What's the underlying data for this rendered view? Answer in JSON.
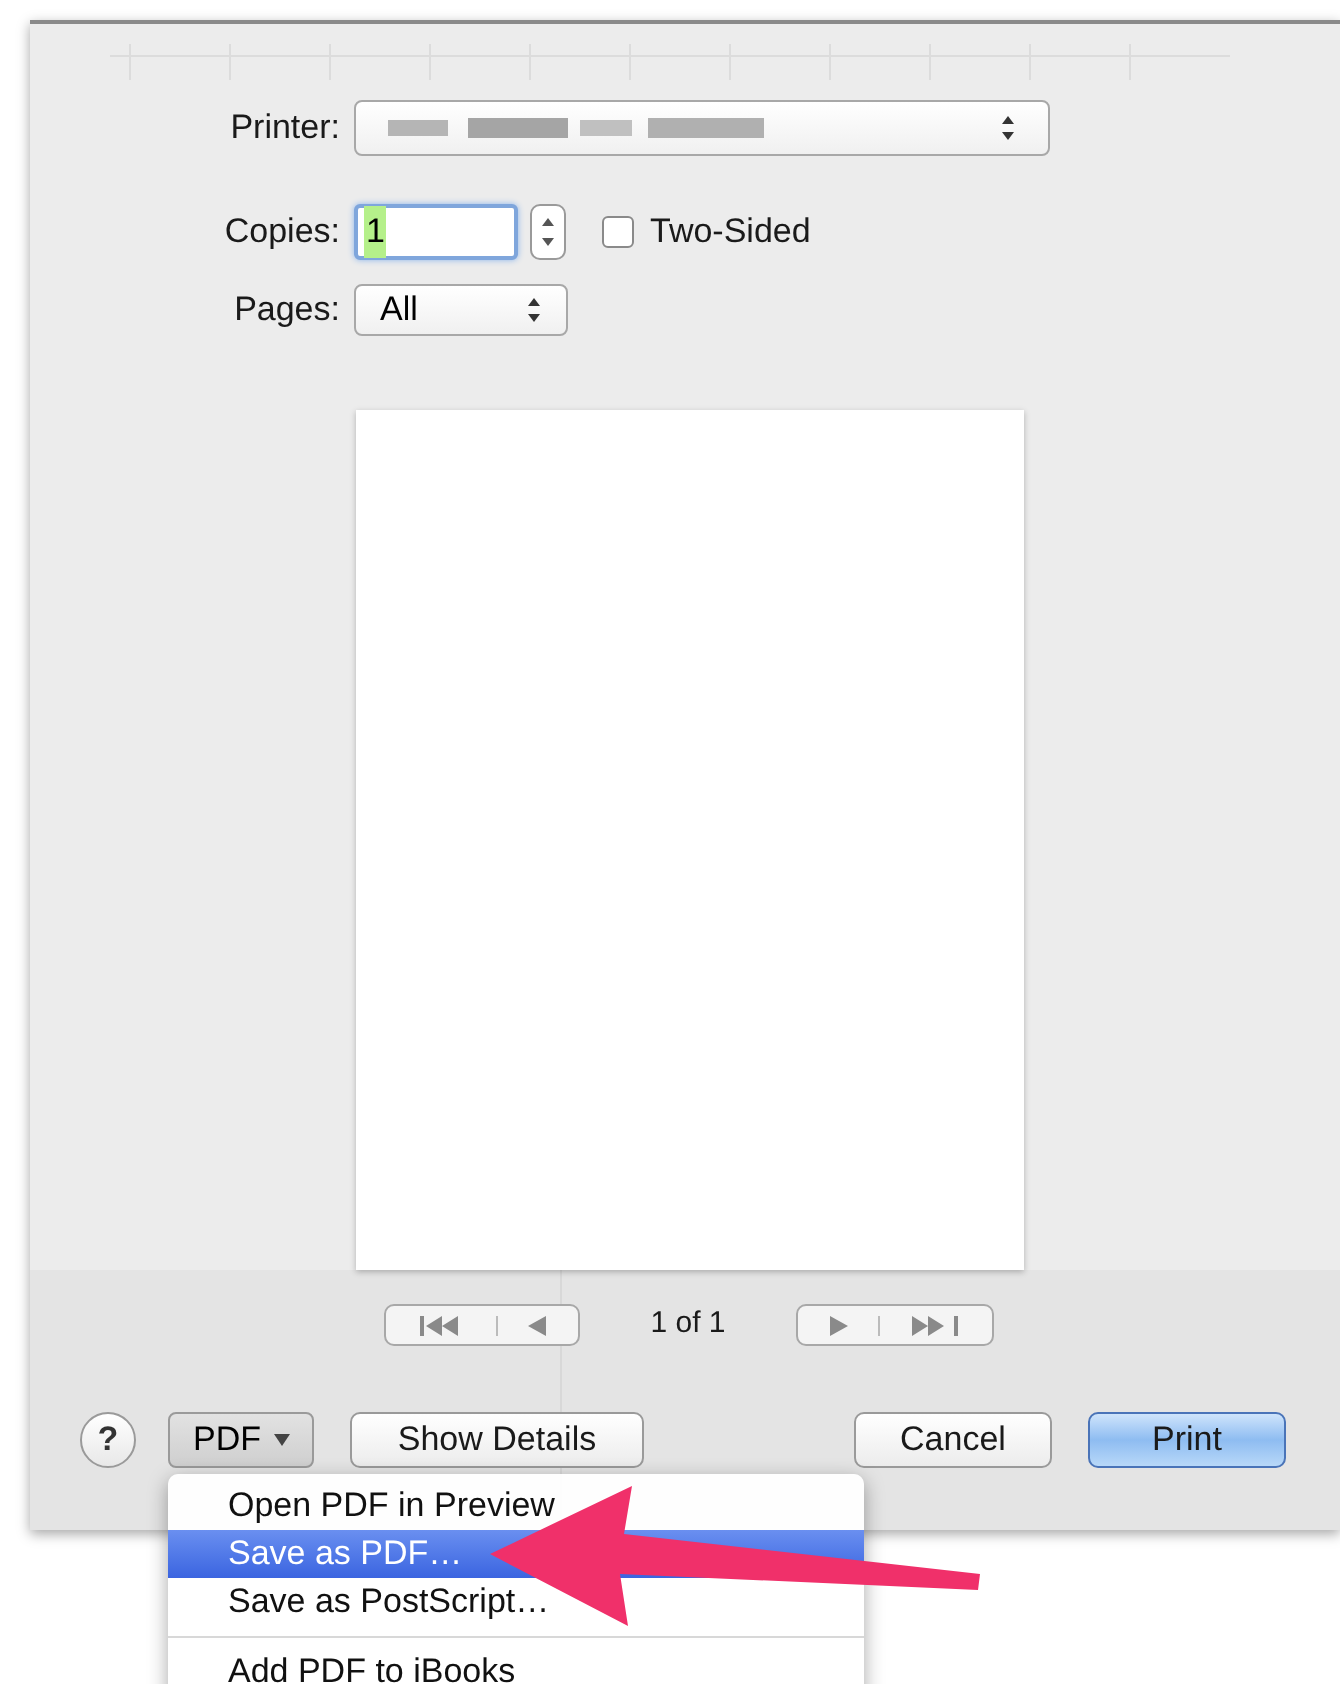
{
  "dialog": {
    "printer": {
      "label": "Printer:"
    },
    "copies": {
      "label": "Copies:",
      "value": "1",
      "text_selected": true
    },
    "two_sided": {
      "label": "Two-Sided",
      "checked": false
    },
    "pages": {
      "label": "Pages:",
      "value": "All"
    },
    "page_indicator": "1 of 1",
    "help": "?",
    "pdf_button": "PDF",
    "buttons": [
      {
        "label": "Show Details",
        "default": false
      },
      {
        "label": "Cancel",
        "default": false
      },
      {
        "label": "Print",
        "default": true
      }
    ]
  },
  "pdf_menu": {
    "items": [
      {
        "label": "Open PDF in Preview",
        "selected": false
      },
      {
        "label": "Save as PDF…",
        "selected": true
      },
      {
        "label": "Save as PostScript…",
        "selected": false
      },
      {
        "label": "Add PDF to iBooks",
        "selected": false
      }
    ]
  }
}
